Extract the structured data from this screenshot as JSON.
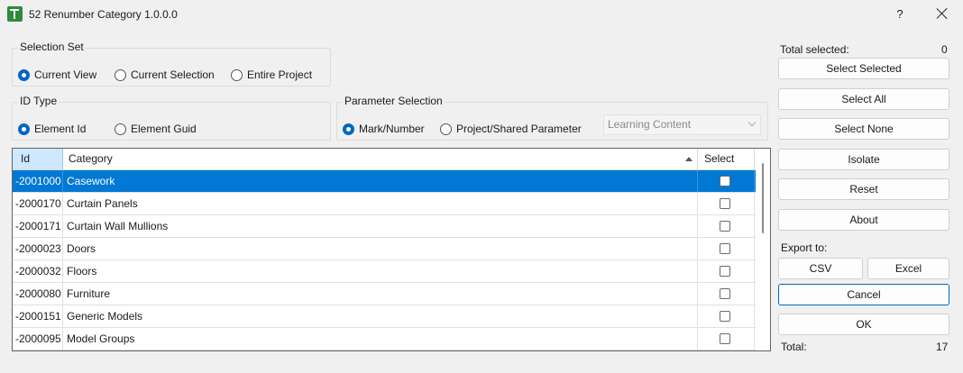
{
  "window": {
    "title": "52 Renumber Category 1.0.0.0",
    "help": "?"
  },
  "selection_set": {
    "title": "Selection Set",
    "options": [
      "Current View",
      "Current Selection",
      "Entire Project"
    ],
    "selected": "Current View"
  },
  "id_type": {
    "title": "ID Type",
    "options": [
      "Element Id",
      "Element Guid"
    ],
    "selected": "Element Id"
  },
  "parameter_selection": {
    "title": "Parameter Selection",
    "options": [
      "Mark/Number",
      "Project/Shared Parameter"
    ],
    "selected": "Mark/Number",
    "dropdown_value": "Learning Content"
  },
  "table": {
    "columns": [
      "Id",
      "Category",
      "Select"
    ],
    "rows": [
      {
        "id": "-2001000",
        "category": "Casework",
        "selected_row": true,
        "checked": false
      },
      {
        "id": "-2000170",
        "category": "Curtain Panels",
        "checked": false
      },
      {
        "id": "-2000171",
        "category": "Curtain Wall Mullions",
        "checked": false
      },
      {
        "id": "-2000023",
        "category": "Doors",
        "checked": false
      },
      {
        "id": "-2000032",
        "category": "Floors",
        "checked": false
      },
      {
        "id": "-2000080",
        "category": "Furniture",
        "checked": false
      },
      {
        "id": "-2000151",
        "category": "Generic Models",
        "checked": false
      },
      {
        "id": "-2000095",
        "category": "Model Groups",
        "checked": false
      }
    ]
  },
  "side": {
    "total_selected_label": "Total selected:",
    "total_selected_value": "0",
    "buttons": {
      "select_selected": "Select Selected",
      "select_all": "Select All",
      "select_none": "Select None",
      "isolate": "Isolate",
      "reset": "Reset",
      "about": "About",
      "csv": "CSV",
      "excel": "Excel",
      "cancel": "Cancel",
      "ok": "OK"
    },
    "export_label": "Export to:",
    "total_label": "Total:",
    "total_value": "17"
  },
  "colors": {
    "accent": "#0078d4",
    "radio": "#0067c0",
    "header_sort": "#cde8ff"
  }
}
